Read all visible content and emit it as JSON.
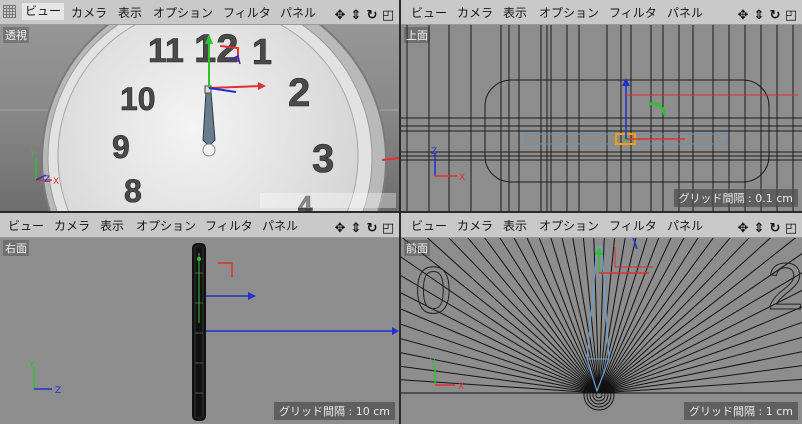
{
  "menu": {
    "view": "ビュー",
    "camera": "カメラ",
    "display": "表示",
    "options": "オプション",
    "filter": "フィルタ",
    "panel": "パネル"
  },
  "viewports": {
    "perspective": {
      "name": "透視"
    },
    "top": {
      "name": "上面",
      "grid_spacing": "グリッド間隔 : 0.1 cm"
    },
    "right": {
      "name": "右面",
      "grid_spacing": "グリッド間隔 : 10 cm"
    },
    "front": {
      "name": "前面",
      "grid_spacing": "グリッド間隔 : 1 cm"
    }
  },
  "clock_numbers": {
    "n12": "12",
    "n1": "1",
    "n2": "2",
    "n3": "3",
    "n10": "10",
    "n11": "11",
    "n9": "9",
    "n8": "8",
    "n4": "4"
  },
  "front_numbers": {
    "n0": "0",
    "n2": "2"
  },
  "axes": {
    "x": "X",
    "y": "Y",
    "z": "Z"
  },
  "nav_icons": [
    "move-icon",
    "dolly-icon",
    "rotate-icon",
    "maximize-icon"
  ],
  "colors": {
    "axis_x": "#e03030",
    "axis_y": "#30c030",
    "axis_z": "#2030d0",
    "selection": "#f0a000"
  }
}
